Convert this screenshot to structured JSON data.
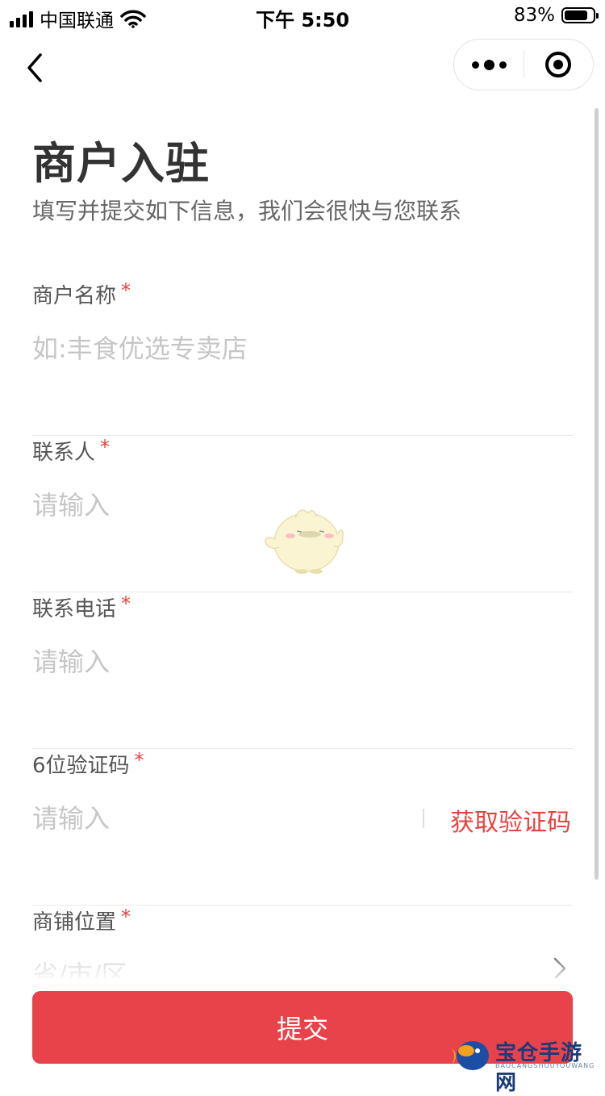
{
  "status_bar": {
    "carrier": "中国联通",
    "time": "下午 5:50",
    "battery": "83%",
    "battery_level": 0.83
  },
  "nav": {
    "back_icon": "chevron-left-icon",
    "more_icon": "more-dots-icon",
    "close_icon": "target-circle-icon"
  },
  "header": {
    "title": "商户入驻",
    "subtitle": "填写并提交如下信息，我们会很快与您联系"
  },
  "form": {
    "required_mark": "*",
    "merchant_name": {
      "label": "商户名称",
      "placeholder": "如:丰食优选专卖店"
    },
    "contact_person": {
      "label": "联系人",
      "placeholder": "请输入"
    },
    "contact_phone": {
      "label": "联系电话",
      "placeholder": "请输入"
    },
    "verification_code": {
      "label": "6位验证码",
      "placeholder": "请输入",
      "get_code_label": "获取验证码"
    },
    "store_location": {
      "label": "商铺位置",
      "placeholder": "省/市/区"
    }
  },
  "submit_label": "提交",
  "watermark": {
    "text": "宝仓手游网",
    "sub": "BAOCANGSHOUYOUWANG"
  },
  "colors": {
    "accent": "#e8424b",
    "required": "#e64340",
    "title": "#333333",
    "subtitle": "#666666",
    "placeholder": "#c6c6c6",
    "divider": "#e8e8e8"
  }
}
